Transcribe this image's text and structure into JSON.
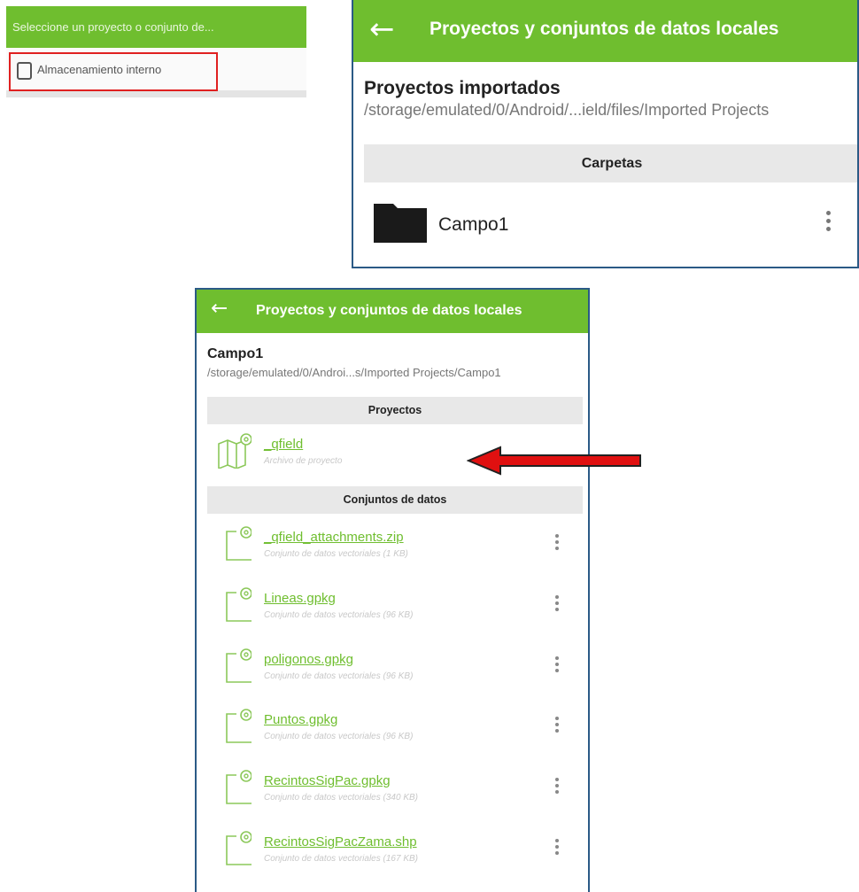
{
  "picker": {
    "title": "Seleccione un proyecto o conjunto de...",
    "storage_label": "Almacenamiento interno"
  },
  "imported": {
    "window_title": "Proyectos y conjuntos de datos locales",
    "section_title": "Proyectos importados",
    "path": "/storage/emulated/0/Android/...ield/files/Imported Projects",
    "folders_header": "Carpetas",
    "folders": [
      {
        "label": "Campo1"
      }
    ]
  },
  "campo": {
    "window_title": "Proyectos y conjuntos de datos locales",
    "folder_title": "Campo1",
    "path": "/storage/emulated/0/Androi...s/Imported Projects/Campo1",
    "projects_header": "Proyectos",
    "projects": [
      {
        "name": "_qfield",
        "meta": "Archivo de proyecto"
      }
    ],
    "datasets_header": "Conjuntos de datos",
    "datasets": [
      {
        "name": "_qfield_attachments.zip",
        "meta": "Conjunto de datos vectoriales (1 KB)"
      },
      {
        "name": "Lineas.gpkg",
        "meta": "Conjunto de datos vectoriales (96 KB)"
      },
      {
        "name": "poligonos.gpkg",
        "meta": "Conjunto de datos vectoriales (96 KB)"
      },
      {
        "name": "Puntos.gpkg",
        "meta": "Conjunto de datos vectoriales (96 KB)"
      },
      {
        "name": "RecintosSigPac.gpkg",
        "meta": "Conjunto de datos vectoriales (340 KB)"
      },
      {
        "name": "RecintosSigPacZama.shp",
        "meta": "Conjunto de datos vectoriales (167 KB)"
      }
    ]
  },
  "colors": {
    "accent": "#6fbe2f",
    "highlight": "#e02020",
    "border": "#2b5a86"
  },
  "icons": {
    "back": "arrow-left-icon",
    "folder": "folder-icon",
    "map": "map-icon",
    "dataset": "dataset-file-icon",
    "more": "more-vert-icon",
    "device": "tablet-icon"
  }
}
